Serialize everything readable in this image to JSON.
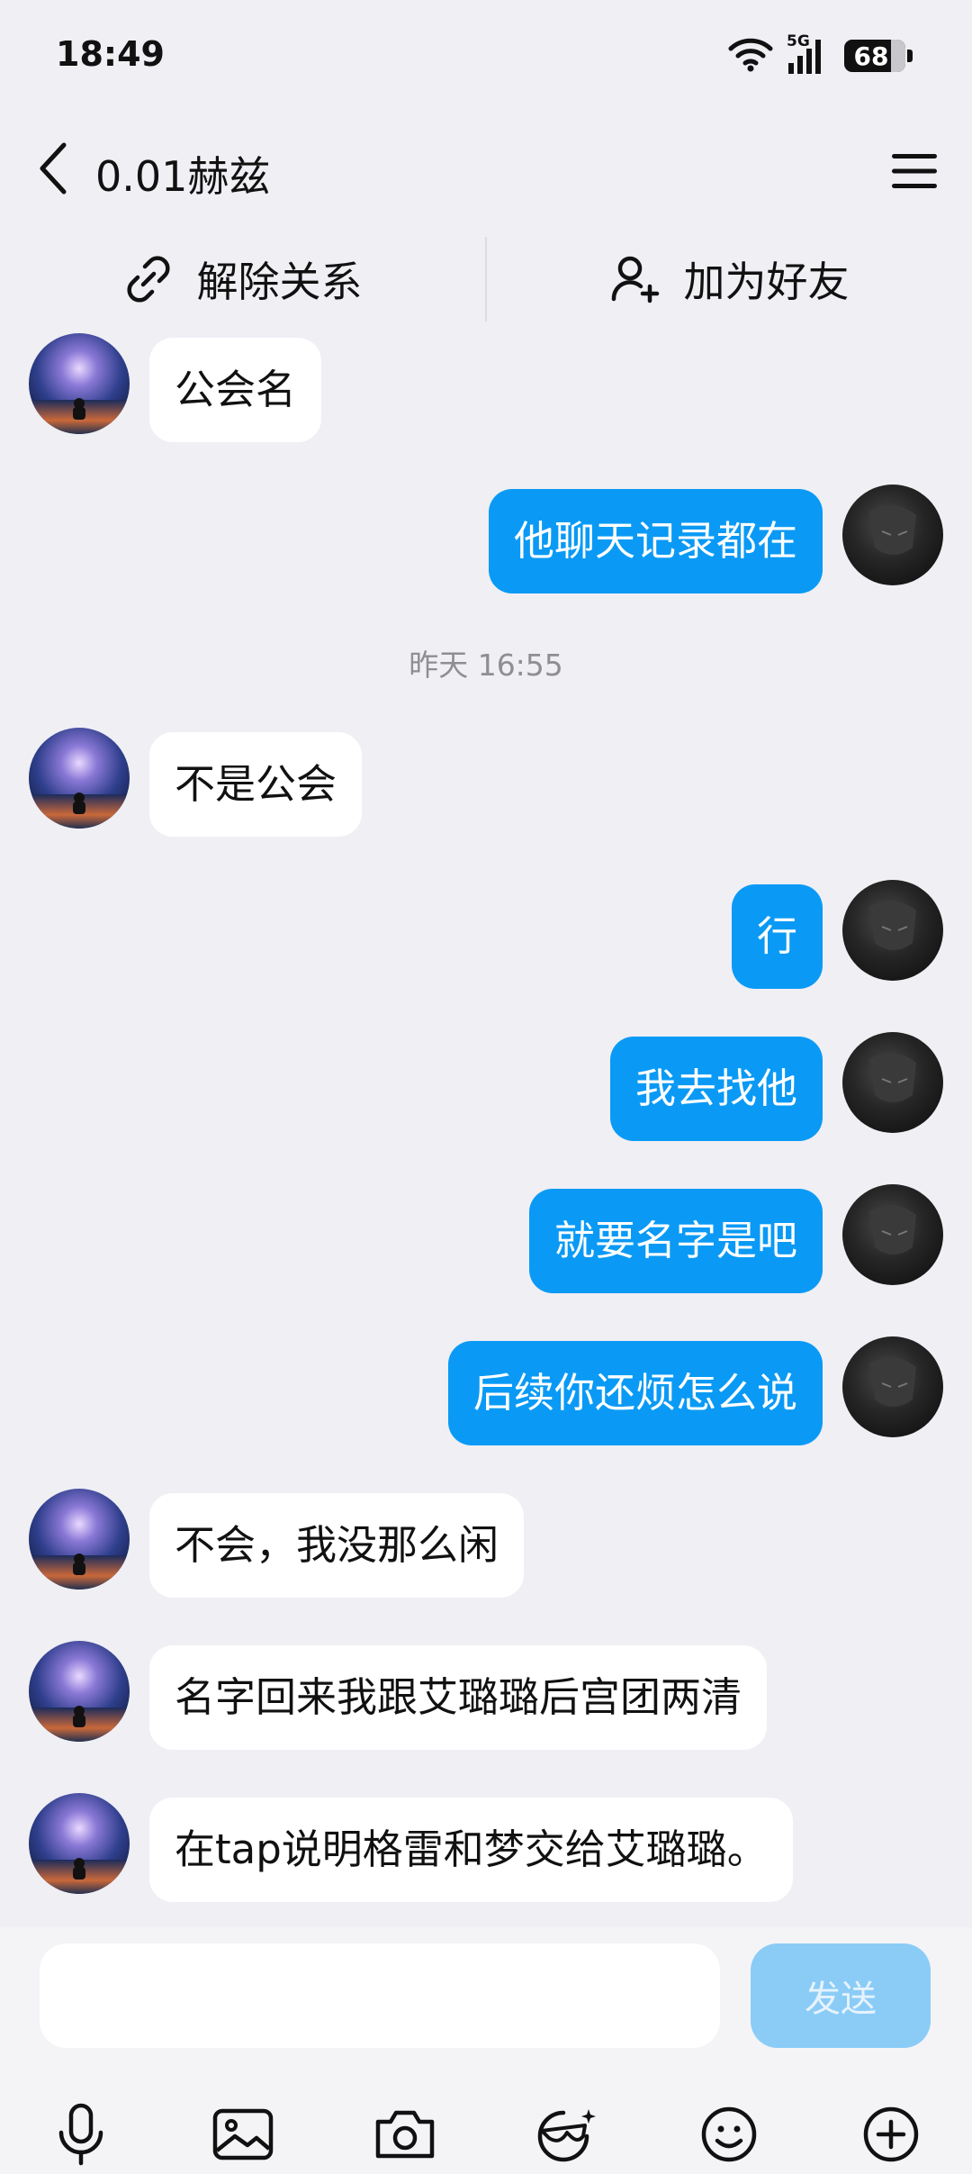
{
  "status_bar": {
    "time": "18:49",
    "network": "5G",
    "battery": "68"
  },
  "header": {
    "title": "0.01赫兹"
  },
  "actions": {
    "unbind_label": "解除关系",
    "add_friend_label": "加为好友"
  },
  "messages": [
    {
      "side": "in",
      "text": "公会名"
    },
    {
      "side": "out",
      "text": "他聊天记录都在"
    },
    {
      "side": "in",
      "text": "不是公会"
    },
    {
      "side": "out",
      "text": "行"
    },
    {
      "side": "out",
      "text": "我去找他"
    },
    {
      "side": "out",
      "text": "就要名字是吧"
    },
    {
      "side": "out",
      "text": "后续你还烦怎么说"
    },
    {
      "side": "in",
      "text": "不会，我没那么闲"
    },
    {
      "side": "in",
      "text": "名字回来我跟艾璐璐后宫团两清"
    },
    {
      "side": "in",
      "text": "在tap说明格雷和梦交给艾璐璐。"
    }
  ],
  "timestamp": "昨天 16:55",
  "composer": {
    "input_value": "",
    "send_label": "发送"
  },
  "toolbar_icons": [
    "microphone-icon",
    "image-icon",
    "camera-icon",
    "sticker-icon",
    "emoji-icon",
    "plus-icon"
  ],
  "colors": {
    "outgoing_bubble": "#0a9af5",
    "incoming_bubble": "#ffffff",
    "background": "#efeff4",
    "send_disabled": "#8bccf7"
  }
}
